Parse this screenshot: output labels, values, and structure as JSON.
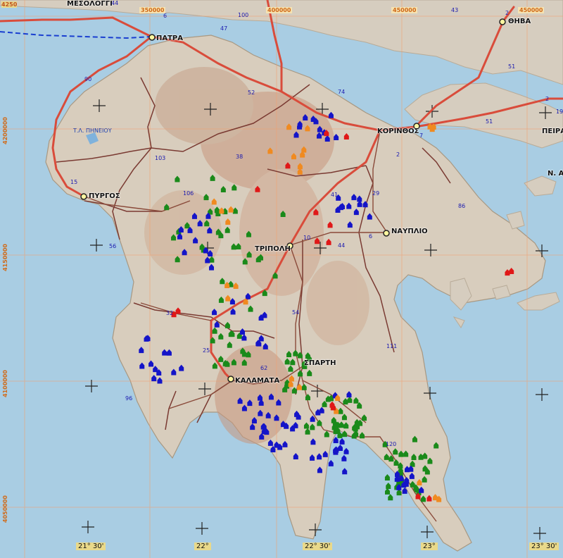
{
  "cities": [
    {
      "name": "ΜΕΣΟΛΟΓΓΙ"
    },
    {
      "name": "ΠΑΤΡΑ"
    },
    {
      "name": "ΘΗΒΑ"
    },
    {
      "name": "ΚΟΡΙΝΘΟΣ"
    },
    {
      "name": "ΠΕΙΡΑ"
    },
    {
      "name": "Ν. Α"
    },
    {
      "name": "ΠΥΡΓΟΣ"
    },
    {
      "name": "ΤΡΙΠΟΛΗ"
    },
    {
      "name": "ΝΑΥΠΛΙΟ"
    },
    {
      "name": "ΣΠΑΡΤΗ"
    },
    {
      "name": "ΚΑΛΑΜΑΤΑ"
    }
  ],
  "lake_label": "Τ.Λ. ΠΗΝΕΙΟΥ",
  "grid_top": [
    "350000",
    "400000",
    "450000"
  ],
  "grid_left": [
    "4200000",
    "4150000",
    "4100000",
    "4050000"
  ],
  "grid_corner": "4250",
  "lon_labels": [
    "21° 30'",
    "22°",
    "22° 30'",
    "23°",
    "23° 30'"
  ],
  "road_numbers": [
    "44",
    "6",
    "100",
    "47",
    "43",
    "2",
    "90",
    "52",
    "74",
    "51",
    "2",
    "19",
    "51",
    "7",
    "2",
    "103",
    "38",
    "15",
    "106",
    "41",
    "29",
    "56",
    "10",
    "86",
    "6",
    "44",
    "32",
    "54",
    "25",
    "62",
    "111",
    "96",
    "120",
    "11"
  ],
  "colors": {
    "sea": "#a9cde3",
    "land": "#d9cfc0",
    "highland": "#c99a80",
    "road_primary": "#d94c3b",
    "road_secondary": "#7a3a32",
    "ferry": "#1a3fd0",
    "marker_green": "#1a8a1a",
    "marker_blue": "#1414c8",
    "marker_orange": "#f08a20",
    "marker_red": "#e01818",
    "grid_line": "#f0a070"
  },
  "markers": {
    "green": 138,
    "blue": 124,
    "orange": 28,
    "red": 16
  }
}
